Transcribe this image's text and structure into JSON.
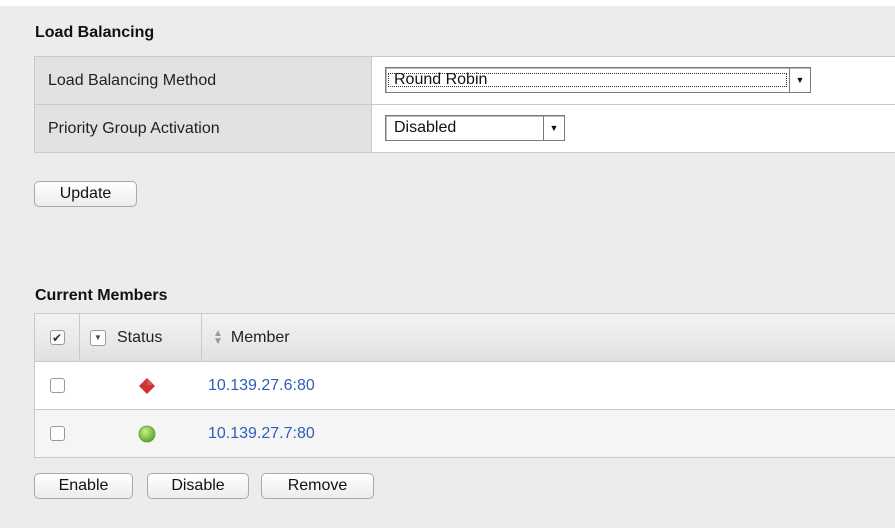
{
  "load_balancing": {
    "title": "Load Balancing",
    "rows": [
      {
        "label": "Load Balancing Method",
        "value": "Round Robin"
      },
      {
        "label": "Priority Group Activation",
        "value": "Disabled"
      }
    ],
    "update_label": "Update"
  },
  "members": {
    "title": "Current Members",
    "headers": {
      "status": "Status",
      "member": "Member"
    },
    "rows": [
      {
        "status": "down",
        "status_color": "#cc3333",
        "address": "10.139.27.6:80"
      },
      {
        "status": "up",
        "status_color": "#7cc43a",
        "address": "10.139.27.7:80"
      }
    ],
    "actions": {
      "enable": "Enable",
      "disable": "Disable",
      "remove": "Remove"
    }
  }
}
